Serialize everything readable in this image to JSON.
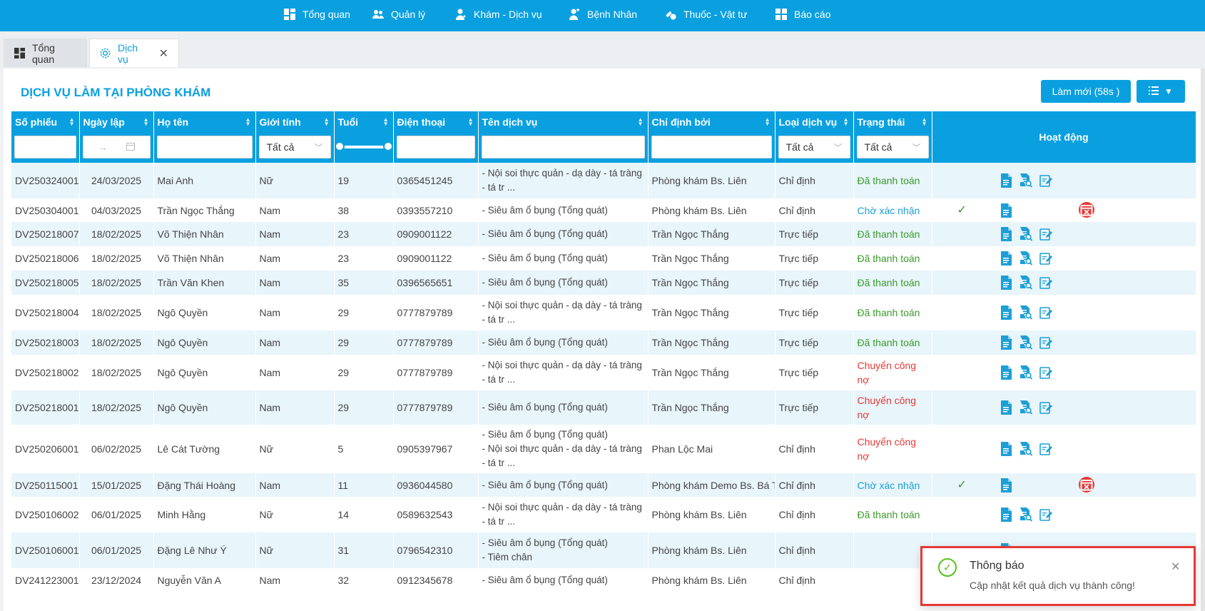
{
  "nav": {
    "items": [
      {
        "label": "Tổng quan",
        "icon": "dashboard-icon"
      },
      {
        "label": "Quản lý",
        "icon": "users-icon"
      },
      {
        "label": "Khám - Dịch vụ",
        "icon": "doctor-icon"
      },
      {
        "label": "Bệnh Nhân",
        "icon": "patient-icon"
      },
      {
        "label": "Thuốc - Vật tư",
        "icon": "medicine-icon"
      },
      {
        "label": "Báo cáo",
        "icon": "report-icon"
      }
    ]
  },
  "tabs": {
    "overview": "Tổng quan",
    "services": "Dịch vụ"
  },
  "page": {
    "title": "DỊCH VỤ LÀM TẠI PHÒNG KHÁM",
    "refresh_label": "Làm mới (58s )"
  },
  "table": {
    "headers": {
      "code": "Số phiếu",
      "date": "Ngày lập",
      "name": "Họ tên",
      "gender": "Giới tính",
      "age": "Tuổi",
      "phone": "Điện thoại",
      "service": "Tên dịch vụ",
      "assigned_by": "Chỉ định bởi",
      "type": "Loại dịch vụ",
      "status": "Trạng thái",
      "actions": "Hoạt động"
    },
    "filters": {
      "gender": "Tất cả",
      "type": "Tất cả",
      "status": "Tất cả",
      "date_arrow": "→"
    },
    "rows": [
      {
        "code": "DV250324001",
        "date": "24/03/2025",
        "name": "Mai Anh",
        "gender": "Nữ",
        "age": "19",
        "phone": "0365451245",
        "service": "- Nội soi thực quản - dạ dày - tá tràng - tá tr ...",
        "assigned_by": "Phòng khám Bs. Liên",
        "type": "Chỉ định",
        "status": "Đã thanh toán",
        "status_kind": "paid"
      },
      {
        "code": "DV250304001",
        "date": "04/03/2025",
        "name": "Trần Ngọc Thắng",
        "gender": "Nam",
        "age": "38",
        "phone": "0393557210",
        "service": "- Siêu âm ổ bụng (Tổng quát)",
        "assigned_by": "Phòng khám Bs. Liên",
        "type": "Chỉ định",
        "status": "Chờ xác nhận",
        "status_kind": "wait"
      },
      {
        "code": "DV250218007",
        "date": "18/02/2025",
        "name": "Võ Thiện Nhân",
        "gender": "Nam",
        "age": "23",
        "phone": "0909001122",
        "service": "- Siêu âm ổ bụng (Tổng quát)",
        "assigned_by": "Trần Ngọc Thắng",
        "type": "Trực tiếp",
        "status": "Đã thanh toán",
        "status_kind": "paid"
      },
      {
        "code": "DV250218006",
        "date": "18/02/2025",
        "name": "Võ Thiện Nhân",
        "gender": "Nam",
        "age": "23",
        "phone": "0909001122",
        "service": "- Siêu âm ổ bụng (Tổng quát)",
        "assigned_by": "Trần Ngọc Thắng",
        "type": "Trực tiếp",
        "status": "Đã thanh toán",
        "status_kind": "paid"
      },
      {
        "code": "DV250218005",
        "date": "18/02/2025",
        "name": "Trần Văn Khen",
        "gender": "Nam",
        "age": "35",
        "phone": "0396565651",
        "service": "- Siêu âm ổ bụng (Tổng quát)",
        "assigned_by": "Trần Ngọc Thắng",
        "type": "Trực tiếp",
        "status": "Đã thanh toán",
        "status_kind": "paid"
      },
      {
        "code": "DV250218004",
        "date": "18/02/2025",
        "name": "Ngô Quyền",
        "gender": "Nam",
        "age": "29",
        "phone": "0777879789",
        "service": "- Nội soi thực quản - dạ dày - tá tràng - tá tr ...",
        "assigned_by": "Trần Ngọc Thắng",
        "type": "Trực tiếp",
        "status": "Đã thanh toán",
        "status_kind": "paid"
      },
      {
        "code": "DV250218003",
        "date": "18/02/2025",
        "name": "Ngô Quyền",
        "gender": "Nam",
        "age": "29",
        "phone": "0777879789",
        "service": "- Siêu âm ổ bụng (Tổng quát)",
        "assigned_by": "Trần Ngọc Thắng",
        "type": "Trực tiếp",
        "status": "Đã thanh toán",
        "status_kind": "paid"
      },
      {
        "code": "DV250218002",
        "date": "18/02/2025",
        "name": "Ngô Quyền",
        "gender": "Nam",
        "age": "29",
        "phone": "0777879789",
        "service": "- Nội soi thực quản - dạ dày - tá tràng - tá tr ...",
        "assigned_by": "Trần Ngọc Thắng",
        "type": "Trực tiếp",
        "status": "Chuyển công nợ",
        "status_kind": "debt"
      },
      {
        "code": "DV250218001",
        "date": "18/02/2025",
        "name": "Ngô Quyền",
        "gender": "Nam",
        "age": "29",
        "phone": "0777879789",
        "service": "- Siêu âm ổ bụng (Tổng quát)",
        "assigned_by": "Trần Ngọc Thắng",
        "type": "Trực tiếp",
        "status": "Chuyển công nợ",
        "status_kind": "debt"
      },
      {
        "code": "DV250206001",
        "date": "06/02/2025",
        "name": "Lê Cát Tường",
        "gender": "Nữ",
        "age": "5",
        "phone": "0905397967",
        "service": "- Siêu âm ổ bụng (Tổng quát)\n- Nội soi thực quản - dạ dày - tá tràng - tá tr ...",
        "assigned_by": "Phan Lộc Mai",
        "type": "Chỉ định",
        "status": "Chuyển công nợ",
        "status_kind": "debt"
      },
      {
        "code": "DV250115001",
        "date": "15/01/2025",
        "name": "Đặng Thái Hoàng",
        "gender": "Nam",
        "age": "11",
        "phone": "0936044580",
        "service": "- Siêu âm ổ bụng (Tổng quát)",
        "assigned_by": "Phòng khám Demo Bs. Bá Tứ",
        "type": "Chỉ định",
        "status": "Chờ xác nhận",
        "status_kind": "wait"
      },
      {
        "code": "DV250106002",
        "date": "06/01/2025",
        "name": "Minh Hằng",
        "gender": "Nữ",
        "age": "14",
        "phone": "0589632543",
        "service": "- Nội soi thực quản - dạ dày - tá tràng - tá tr ...",
        "assigned_by": "Phòng khám Bs. Liên",
        "type": "Chỉ định",
        "status": "Đã thanh toán",
        "status_kind": "paid"
      },
      {
        "code": "DV250106001",
        "date": "06/01/2025",
        "name": "Đặng Lê Như Ý",
        "gender": "Nữ",
        "age": "31",
        "phone": "0796542310",
        "service": "- Siêu âm ổ bụng (Tổng quát)\n- Tiêm chân",
        "assigned_by": "Phòng khám Bs. Liên",
        "type": "Chỉ định",
        "status": "",
        "status_kind": "none"
      },
      {
        "code": "DV241223001",
        "date": "23/12/2024",
        "name": "Nguyễn Văn A",
        "gender": "Nam",
        "age": "32",
        "phone": "0912345678",
        "service": "- Siêu âm ổ bụng (Tổng quát)",
        "assigned_by": "Phòng khám Bs. Liên",
        "type": "Chỉ định",
        "status": "",
        "status_kind": "none"
      }
    ]
  },
  "toast": {
    "title": "Thông báo",
    "message": "Cập nhật kết quả dịch vụ thành công!"
  },
  "colors": {
    "primary": "#0aa0e0",
    "paid": "#3a9b2a",
    "waiting": "#1d9fd6",
    "debt": "#e53935"
  }
}
